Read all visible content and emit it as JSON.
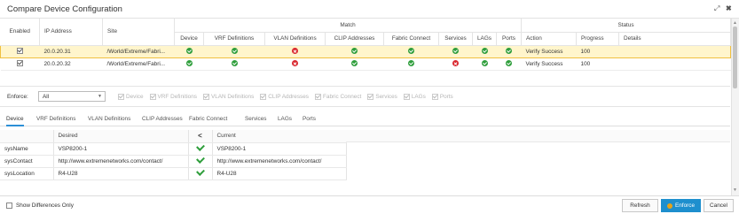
{
  "window": {
    "title": "Compare Device Configuration",
    "expand_icon": "expand-arrows-icon",
    "close_icon": "close-icon"
  },
  "upper_table": {
    "group_match": "Match",
    "group_status": "Status",
    "columns": {
      "enabled": "Enabled",
      "ip": "IP Address",
      "site": "Site",
      "device": "Device",
      "vrf": "VRF Definitions",
      "vlan": "VLAN Definitions",
      "clip": "CLIP Addresses",
      "fabric": "Fabric Connect",
      "services": "Services",
      "lags": "LAGs",
      "ports": "Ports",
      "action": "Action",
      "progress": "Progress",
      "details": "Details"
    },
    "rows": [
      {
        "enabled": true,
        "ip": "20.0.20.31",
        "site": "/World/Extreme/Fabri...",
        "match": [
          "ok",
          "ok",
          "err",
          "ok",
          "ok",
          "ok",
          "ok",
          "ok"
        ],
        "action": "Verify Success",
        "progress": "100",
        "details": "",
        "selected": true
      },
      {
        "enabled": true,
        "ip": "20.0.20.32",
        "site": "/World/Extreme/Fabri...",
        "match": [
          "ok",
          "ok",
          "err",
          "ok",
          "ok",
          "err",
          "ok",
          "ok"
        ],
        "action": "Verify Success",
        "progress": "100",
        "details": "",
        "selected": false
      }
    ]
  },
  "enforce": {
    "label": "Enforce:",
    "selected": "All",
    "options": [
      "Device",
      "VRF Definitions",
      "VLAN Definitions",
      "CLIP Addresses",
      "Fabric Connect",
      "Services",
      "LAGs",
      "Ports"
    ]
  },
  "tabs": [
    "Device",
    "VRF Definitions",
    "VLAN Definitions",
    "CLIP Addresses",
    "Fabric Connect",
    "Services",
    "LAGs",
    "Ports"
  ],
  "active_tab": "Device",
  "diff_table": {
    "col_desired": "Desired",
    "col_arrow": "<",
    "col_current": "Current",
    "rows": [
      {
        "name": "sysName",
        "desired": "VSP8200-1",
        "current": "VSP8200-1"
      },
      {
        "name": "sysContact",
        "desired": "http://www.extremenetworks.com/contact/",
        "current": "http://www.extremenetworks.com/contact/"
      },
      {
        "name": "sysLocation",
        "desired": "R4-U28",
        "current": "R4-U28"
      }
    ]
  },
  "footer": {
    "show_diff_label": "Show Differences Only",
    "refresh": "Refresh",
    "enforce": "Enforce",
    "cancel": "Cancel"
  },
  "colors": {
    "selected_row_bg": "#fff5cc",
    "ok_green": "#2f9e3c",
    "error_red": "#d9262e",
    "primary_blue": "#1e8fce",
    "tab_underline": "#2c8fd6"
  }
}
